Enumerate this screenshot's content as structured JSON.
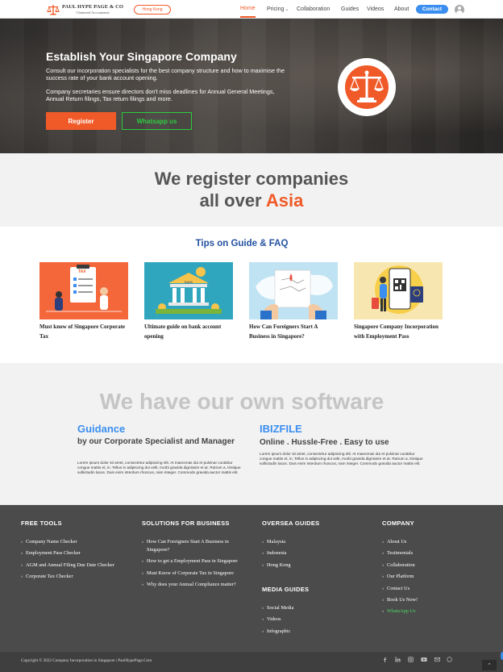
{
  "nav": {
    "logo_title": "PAUL HYPE PAGE & CO",
    "logo_subtitle": "Chartered Accountants",
    "region": "Hong Kong",
    "items": [
      "Home",
      "Pricing",
      "Collaboration",
      "Guides",
      "Videos",
      "About"
    ],
    "pricing_chevron": "⌄",
    "contact": "Contact",
    "active_item": "Home"
  },
  "hero": {
    "title": "Establish Your Singapore Company",
    "p1": "Consult our incorporation specialists for the best company structure and how to maximise the success rate of your bank account opening.",
    "p2": "Company secretaries ensure directors don't miss deadlines for Annual General Meetings, Annual Return filings, Tax return filings and more.",
    "register": "Register",
    "whatsapp": "Whatsapp us"
  },
  "asia": {
    "line1": "We register companies",
    "line2_pre": "all over ",
    "line2_highlight": "Asia"
  },
  "tips": {
    "title": "Tips on Guide & FAQ",
    "cards": [
      {
        "caption": "Must know of Singapore Corporate Tax",
        "badge": "TAX"
      },
      {
        "caption": "Ultimate guide on bank account opening",
        "badge": "BANK"
      },
      {
        "caption": "How Can Foreigners Start A Business in Singapore?",
        "badge": ""
      },
      {
        "caption": "Singapore Company Incorporation with Employment Pass",
        "badge": ""
      }
    ]
  },
  "software": {
    "title": "We have our own software",
    "guidance": {
      "name": "Guidance",
      "tagline": "by our Corporate Specialist and Manager",
      "body": "Lorem ipsum dolor sit amet, consectetur adipiscing elit. At maecenas dui et pulvinar curabitur congue mattis et, in. Tellus in adipiscing dui velit, morbi gravida dignissim et at. Rutrum a, tristique sollicitudin lacus. Duis enim interdum rhoncus, nam integer. Commodo gravida auctor mattis elit."
    },
    "ibizfile": {
      "name": "IBIZFILE",
      "tagline": "Online . Hussle-Free . Easy to use",
      "body": "Lorem ipsum dolor sit amet, consectetur adipiscing elit. At maecenas dui et pulvinar curabitur congue mattis et, in. Tellus in adipiscing dui velit, morbi gravida dignissim et at. Rutrum a, tristique sollicitudin lacus. Duis enim interdum rhoncus, nam integer. Commodo gravida auctor mattis elit."
    }
  },
  "footer": {
    "free_tools": {
      "heading": "FREE TOOLS",
      "items": [
        "Company Name Checker",
        "Employment Pass Checker",
        "AGM and Annual Filing Due Date Checker",
        "Corporate Tax Checker"
      ]
    },
    "solutions": {
      "heading": "SOLUTIONS FOR BUSINESS",
      "items": [
        "How Can Foreigners Start A Business in Singapore?",
        "How to get a Employment Pass in Singapore",
        "Must Know of Corporate Tax in Singapore",
        "Why does your Annual Compliance matter?"
      ]
    },
    "oversea": {
      "heading": "OVERSEA GUIDES",
      "items": [
        "Malaysia",
        "Indonesia",
        "Hong Kong"
      ]
    },
    "media": {
      "heading": "MEDIA GUIDES",
      "items": [
        "Social Media",
        "Videos",
        "Infographic"
      ]
    },
    "company": {
      "heading": "COMPANY",
      "items": [
        "About Us",
        "Testimonials",
        "Collaboration",
        "Our Platform",
        "Contact Us",
        "Book Us Now!",
        "WhatsApp Us"
      ]
    },
    "copyright": "Copyright © 2022 Company Incorporation in Singapore | PaulHypePage.Com",
    "social_icons": [
      "facebook-icon",
      "linkedin-icon",
      "instagram-icon",
      "youtube-icon",
      "email-icon",
      "whatsapp-icon"
    ],
    "back_to_top": "⌃"
  },
  "colors": {
    "brand_orange": "#f05a28",
    "accent_blue": "#3a8ef0",
    "whatsapp_green": "#2ecc40",
    "footer_bg": "#4b4b4b",
    "tips_blue": "#2452a0"
  }
}
